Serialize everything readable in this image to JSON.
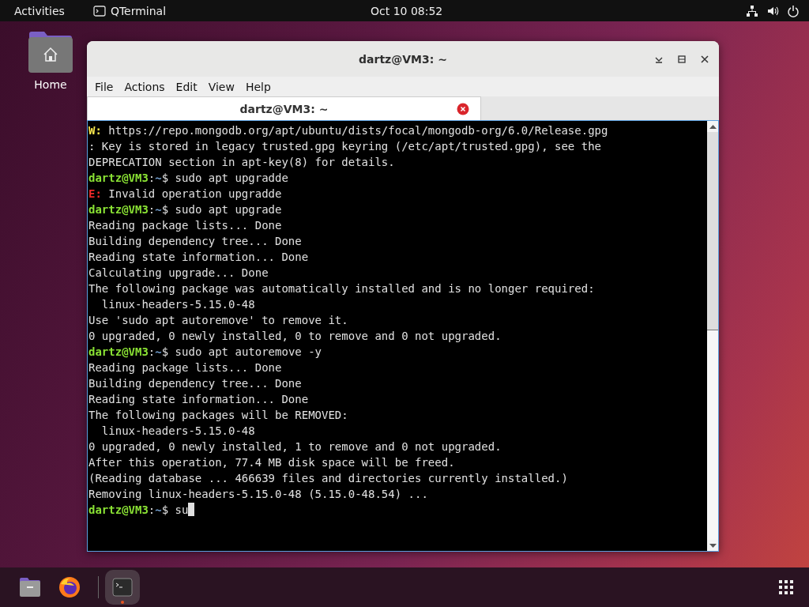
{
  "top_bar": {
    "activities": "Activities",
    "app_name": "QTerminal",
    "clock": "Oct 10  08:52"
  },
  "desktop": {
    "icons": [
      {
        "label": "Home"
      }
    ]
  },
  "window": {
    "title": "dartz@VM3: ~",
    "menu": [
      "File",
      "Actions",
      "Edit",
      "View",
      "Help"
    ],
    "tabs": [
      {
        "label": "dartz@VM3: ~",
        "selected": true
      }
    ],
    "terminal": {
      "lines": [
        {
          "kind": "warning",
          "tag": "W:",
          "text": " https://repo.mongodb.org/apt/ubuntu/dists/focal/mongodb-org/6.0/Release.gpg"
        },
        {
          "kind": "output",
          "text": ": Key is stored in legacy trusted.gpg keyring (/etc/apt/trusted.gpg), see the"
        },
        {
          "kind": "output",
          "text": "DEPRECATION section in apt-key(8) for details."
        },
        {
          "kind": "prompt",
          "user": "dartz@VM3",
          "sep": ":",
          "path": "~",
          "command": "$ sudo apt upgradde"
        },
        {
          "kind": "error",
          "tag": "E:",
          "text": " Invalid operation upgradde"
        },
        {
          "kind": "prompt",
          "user": "dartz@VM3",
          "sep": ":",
          "path": "~",
          "command": "$ sudo apt upgrade"
        },
        {
          "kind": "output",
          "text": "Reading package lists... Done"
        },
        {
          "kind": "output",
          "text": "Building dependency tree... Done"
        },
        {
          "kind": "output",
          "text": "Reading state information... Done"
        },
        {
          "kind": "output",
          "text": "Calculating upgrade... Done"
        },
        {
          "kind": "output",
          "text": "The following package was automatically installed and is no longer required:"
        },
        {
          "kind": "output",
          "text": "  linux-headers-5.15.0-48"
        },
        {
          "kind": "output",
          "text": "Use 'sudo apt autoremove' to remove it."
        },
        {
          "kind": "output",
          "text": "0 upgraded, 0 newly installed, 0 to remove and 0 not upgraded."
        },
        {
          "kind": "prompt",
          "user": "dartz@VM3",
          "sep": ":",
          "path": "~",
          "command": "$ sudo apt autoremove -y"
        },
        {
          "kind": "output",
          "text": "Reading package lists... Done"
        },
        {
          "kind": "output",
          "text": "Building dependency tree... Done"
        },
        {
          "kind": "output",
          "text": "Reading state information... Done"
        },
        {
          "kind": "output",
          "text": "The following packages will be REMOVED:"
        },
        {
          "kind": "output",
          "text": "  linux-headers-5.15.0-48"
        },
        {
          "kind": "output",
          "text": "0 upgraded, 0 newly installed, 1 to remove and 0 not upgraded."
        },
        {
          "kind": "output",
          "text": "After this operation, 77.4 MB disk space will be freed."
        },
        {
          "kind": "output",
          "text": "(Reading database ... 466639 files and directories currently installed.)"
        },
        {
          "kind": "output",
          "text": "Removing linux-headers-5.15.0-48 (5.15.0-48.54) ..."
        },
        {
          "kind": "prompt",
          "user": "dartz@VM3",
          "sep": ":",
          "path": "~",
          "command": "$ su",
          "cursor": true
        }
      ]
    }
  }
}
